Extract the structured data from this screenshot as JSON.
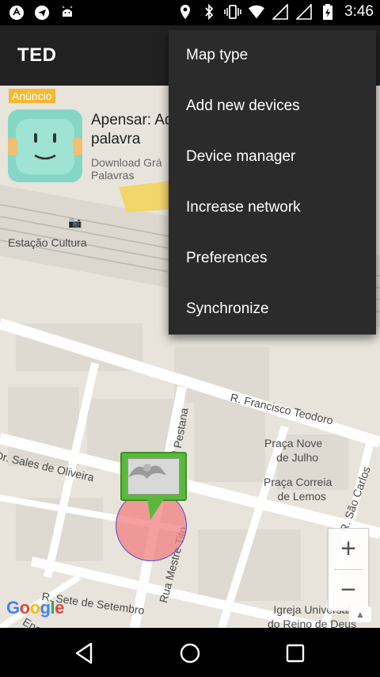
{
  "status_bar": {
    "time": "3:46",
    "left_icons": [
      "android-debug-icon",
      "telegram-icon",
      "android-icon"
    ],
    "right_icons": [
      "location-icon",
      "bluetooth-icon",
      "vibrate-icon",
      "wifi-icon",
      "signal-icon",
      "signal-2-icon",
      "battery-charging-icon"
    ]
  },
  "app_bar": {
    "title": "TED"
  },
  "menu": {
    "items": [
      "Map type",
      "Add new devices",
      "Device manager",
      "Increase network",
      "Preferences",
      "Synchronize"
    ]
  },
  "ad": {
    "badge": "Anúncio",
    "title_line1": "Apensar: Ad",
    "title_line2": "palavra",
    "subtitle_line1": "Download Grá",
    "subtitle_line2": "Palavras"
  },
  "map": {
    "labels": {
      "estacao": "Estação Cultura",
      "r_francisco": "R. Francisco Teodoro",
      "praca_nove_1": "Praça Nove",
      "praca_nove_2": "de Julho",
      "praca_correia_1": "Praça Correia",
      "praca_correia_2": "de Lemos",
      "sales_oliveira": "Dr. Sales de Oliveira",
      "pestana": "gel Pestana",
      "sao_carlos": "R. São Carlos",
      "sete_setembro": "R. Sete de Setembro",
      "mestre_tito": "Rua Mestre Tito",
      "igreja_1": "Igreja Universal",
      "igreja_2": "do Reino de Deus",
      "eng": "Eng"
    },
    "google_logo": "Google",
    "zoom_in": "+",
    "zoom_out": "−"
  },
  "nav_bar": {
    "icons": [
      "back-icon",
      "home-icon",
      "recents-icon"
    ]
  }
}
